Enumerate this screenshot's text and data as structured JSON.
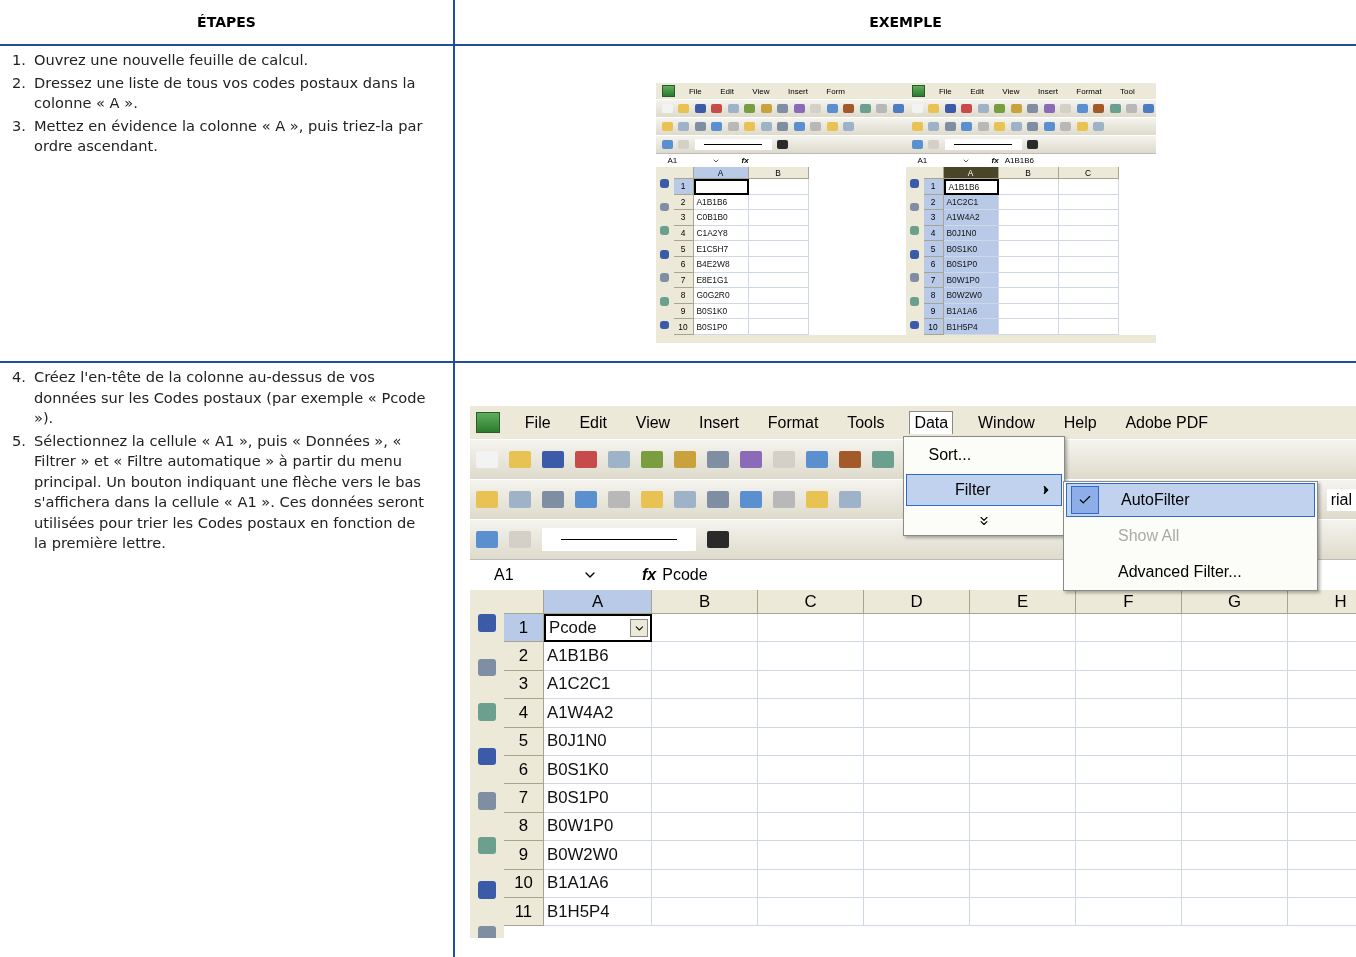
{
  "table": {
    "columns": [
      "ÉTAPES",
      "EXEMPLE"
    ],
    "rows": [
      {
        "steps": [
          {
            "number": "1.",
            "text": "Ouvrez une nouvelle feuille de calcul."
          },
          {
            "number": "2.",
            "text": "Dressez une liste de tous vos codes postaux dans la colonne « A »."
          },
          {
            "number": "3.",
            "text": "Mettez en évidence la colonne « A », puis triez-la par ordre ascendant."
          }
        ],
        "example": {
          "kind": "side_by_side",
          "panes": [
            {
              "menu": [
                {
                  "label": "File",
                  "selected": false
                },
                {
                  "label": "Edit",
                  "selected": false
                },
                {
                  "label": "View",
                  "selected": false
                },
                {
                  "label": "Insert",
                  "selected": false
                },
                {
                  "label": "Form",
                  "selected": false
                }
              ],
              "name_box": "A1",
              "formula_label": "fx",
              "columns": [
                {
                  "label": "A",
                  "selected": true
                },
                {
                  "label": "B",
                  "selected": false
                }
              ],
              "rows": [
                {
                  "number": "1",
                  "selected": true,
                  "active": true,
                  "filter_button": false
                },
                {
                  "number": "2",
                  "value": "A1B1B6",
                  "selected": false,
                  "active": false,
                  "filter_button": false
                },
                {
                  "number": "3",
                  "value": "C0B1B0",
                  "selected": false,
                  "active": false,
                  "filter_button": false
                },
                {
                  "number": "4",
                  "value": "C1A2Y8",
                  "selected": false,
                  "active": false,
                  "filter_button": false
                },
                {
                  "number": "5",
                  "value": "E1C5H7",
                  "selected": false,
                  "active": false,
                  "filter_button": false
                },
                {
                  "number": "6",
                  "value": "B4E2W8",
                  "selected": false,
                  "active": false,
                  "filter_button": false
                },
                {
                  "number": "7",
                  "value": "E8E1G1",
                  "selected": false,
                  "active": false,
                  "filter_button": false
                },
                {
                  "number": "8",
                  "value": "G0G2R0",
                  "selected": false,
                  "active": false,
                  "filter_button": false
                },
                {
                  "number": "9",
                  "value": "B0S1K0",
                  "selected": false,
                  "active": false,
                  "filter_button": false
                },
                {
                  "number": "10",
                  "value": "B0S1P0",
                  "selected": false,
                  "active": false,
                  "filter_button": false
                }
              ]
            },
            {
              "menu": [
                {
                  "label": "File",
                  "selected": false
                },
                {
                  "label": "Edit",
                  "selected": false
                },
                {
                  "label": "View",
                  "selected": false
                },
                {
                  "label": "Insert",
                  "selected": false
                },
                {
                  "label": "Format",
                  "selected": false
                },
                {
                  "label": "Tool",
                  "selected": false
                }
              ],
              "name_box": "A1",
              "formula_label": "fx",
              "formula": "A1B1B6",
              "columns": [
                {
                  "label": "A",
                  "selected": true
                },
                {
                  "label": "B",
                  "selected": false
                },
                {
                  "label": "C",
                  "selected": false
                }
              ],
              "rows": [
                {
                  "number": "1",
                  "value": "A1B1B6",
                  "selected": true,
                  "active": true,
                  "filter_button": false
                },
                {
                  "number": "2",
                  "value": "A1C2C1",
                  "selected": true,
                  "active": false,
                  "filter_button": false
                },
                {
                  "number": "3",
                  "value": "A1W4A2",
                  "selected": true,
                  "active": false,
                  "filter_button": false
                },
                {
                  "number": "4",
                  "value": "B0J1N0",
                  "selected": true,
                  "active": false,
                  "filter_button": false
                },
                {
                  "number": "5",
                  "value": "B0S1K0",
                  "selected": true,
                  "active": false,
                  "filter_button": false
                },
                {
                  "number": "6",
                  "value": "B0S1P0",
                  "selected": true,
                  "active": false,
                  "filter_button": false
                },
                {
                  "number": "7",
                  "value": "B0W1P0",
                  "selected": true,
                  "active": false,
                  "filter_button": false
                },
                {
                  "number": "8",
                  "value": "B0W2W0",
                  "selected": true,
                  "active": false,
                  "filter_button": false
                },
                {
                  "number": "9",
                  "value": "B1A1A6",
                  "selected": true,
                  "active": false,
                  "filter_button": false
                },
                {
                  "number": "10",
                  "value": "B1H5P4",
                  "selected": true,
                  "active": false,
                  "filter_button": false
                }
              ]
            }
          ]
        }
      },
      {
        "steps": [
          {
            "number": "4.",
            "text": "Créez l'en-tête de la colonne au-dessus de vos données sur les Codes postaux (par exemple « Pcode »)."
          },
          {
            "number": "5.",
            "text": "Sélectionnez la cellule « A1 », puis « Données », « Filtrer » et « Filtre automatique » à partir du menu principal. Un bouton indiquant une flèche vers le bas s'affichera dans la cellule « A1 ». Ces données seront utilisées pour trier les Codes postaux en fonction de la première lettre."
          }
        ],
        "example": {
          "kind": "menu_sheet",
          "panes": [
            {
              "menu": [
                {
                  "label": "File",
                  "selected": false
                },
                {
                  "label": "Edit",
                  "selected": false
                },
                {
                  "label": "View",
                  "selected": false
                },
                {
                  "label": "Insert",
                  "selected": false
                },
                {
                  "label": "Format",
                  "selected": false
                },
                {
                  "label": "Tools",
                  "selected": false
                },
                {
                  "label": "Data",
                  "selected": true
                },
                {
                  "label": "Window",
                  "selected": false
                },
                {
                  "label": "Help",
                  "selected": false
                },
                {
                  "label": "Adobe PDF",
                  "selected": false
                }
              ],
              "font_box": "rial",
              "name_box": "A1",
              "formula_label": "fx",
              "formula": "Pcode",
              "columns": [
                {
                  "label": "A",
                  "selected": true
                },
                {
                  "label": "B",
                  "selected": false
                },
                {
                  "label": "C",
                  "selected": false
                },
                {
                  "label": "D",
                  "selected": false
                },
                {
                  "label": "E",
                  "selected": false
                },
                {
                  "label": "F",
                  "selected": false
                },
                {
                  "label": "G",
                  "selected": false
                },
                {
                  "label": "H",
                  "selected": false
                }
              ],
              "rows": [
                {
                  "number": "1",
                  "value": "Pcode",
                  "selected": true,
                  "active": true,
                  "filter_button": true
                },
                {
                  "number": "2",
                  "value": "A1B1B6",
                  "selected": false,
                  "active": false,
                  "filter_button": false
                },
                {
                  "number": "3",
                  "value": "A1C2C1",
                  "selected": false,
                  "active": false,
                  "filter_button": false
                },
                {
                  "number": "4",
                  "value": "A1W4A2",
                  "selected": false,
                  "active": false,
                  "filter_button": false
                },
                {
                  "number": "5",
                  "value": "B0J1N0",
                  "selected": false,
                  "active": false,
                  "filter_button": false
                },
                {
                  "number": "6",
                  "value": "B0S1K0",
                  "selected": false,
                  "active": false,
                  "filter_button": false
                },
                {
                  "number": "7",
                  "value": "B0S1P0",
                  "selected": false,
                  "active": false,
                  "filter_button": false
                },
                {
                  "number": "8",
                  "value": "B0W1P0",
                  "selected": false,
                  "active": false,
                  "filter_button": false
                },
                {
                  "number": "9",
                  "value": "B0W2W0",
                  "selected": false,
                  "active": false,
                  "filter_button": false
                },
                {
                  "number": "10",
                  "value": "B1A1A6",
                  "selected": false,
                  "active": false,
                  "filter_button": false
                },
                {
                  "number": "11",
                  "value": "B1H5P4",
                  "selected": false,
                  "active": false,
                  "filter_button": false
                }
              ],
              "data_menu": [
                {
                  "kind": "sort",
                  "label": "Sort...",
                  "selected": false
                },
                {
                  "kind": "submenu",
                  "label": "Filter",
                  "selected": true
                },
                {
                  "kind": "more",
                  "selected": false
                }
              ],
              "filter_submenu": [
                {
                  "label": "AutoFilter",
                  "checked": true,
                  "selected": true,
                  "disabled": false
                },
                {
                  "label": "Show All",
                  "checked": false,
                  "selected": false,
                  "disabled": true
                },
                {
                  "label": "Advanced Filter...",
                  "checked": false,
                  "selected": false,
                  "disabled": false
                }
              ]
            }
          ]
        }
      }
    ]
  }
}
